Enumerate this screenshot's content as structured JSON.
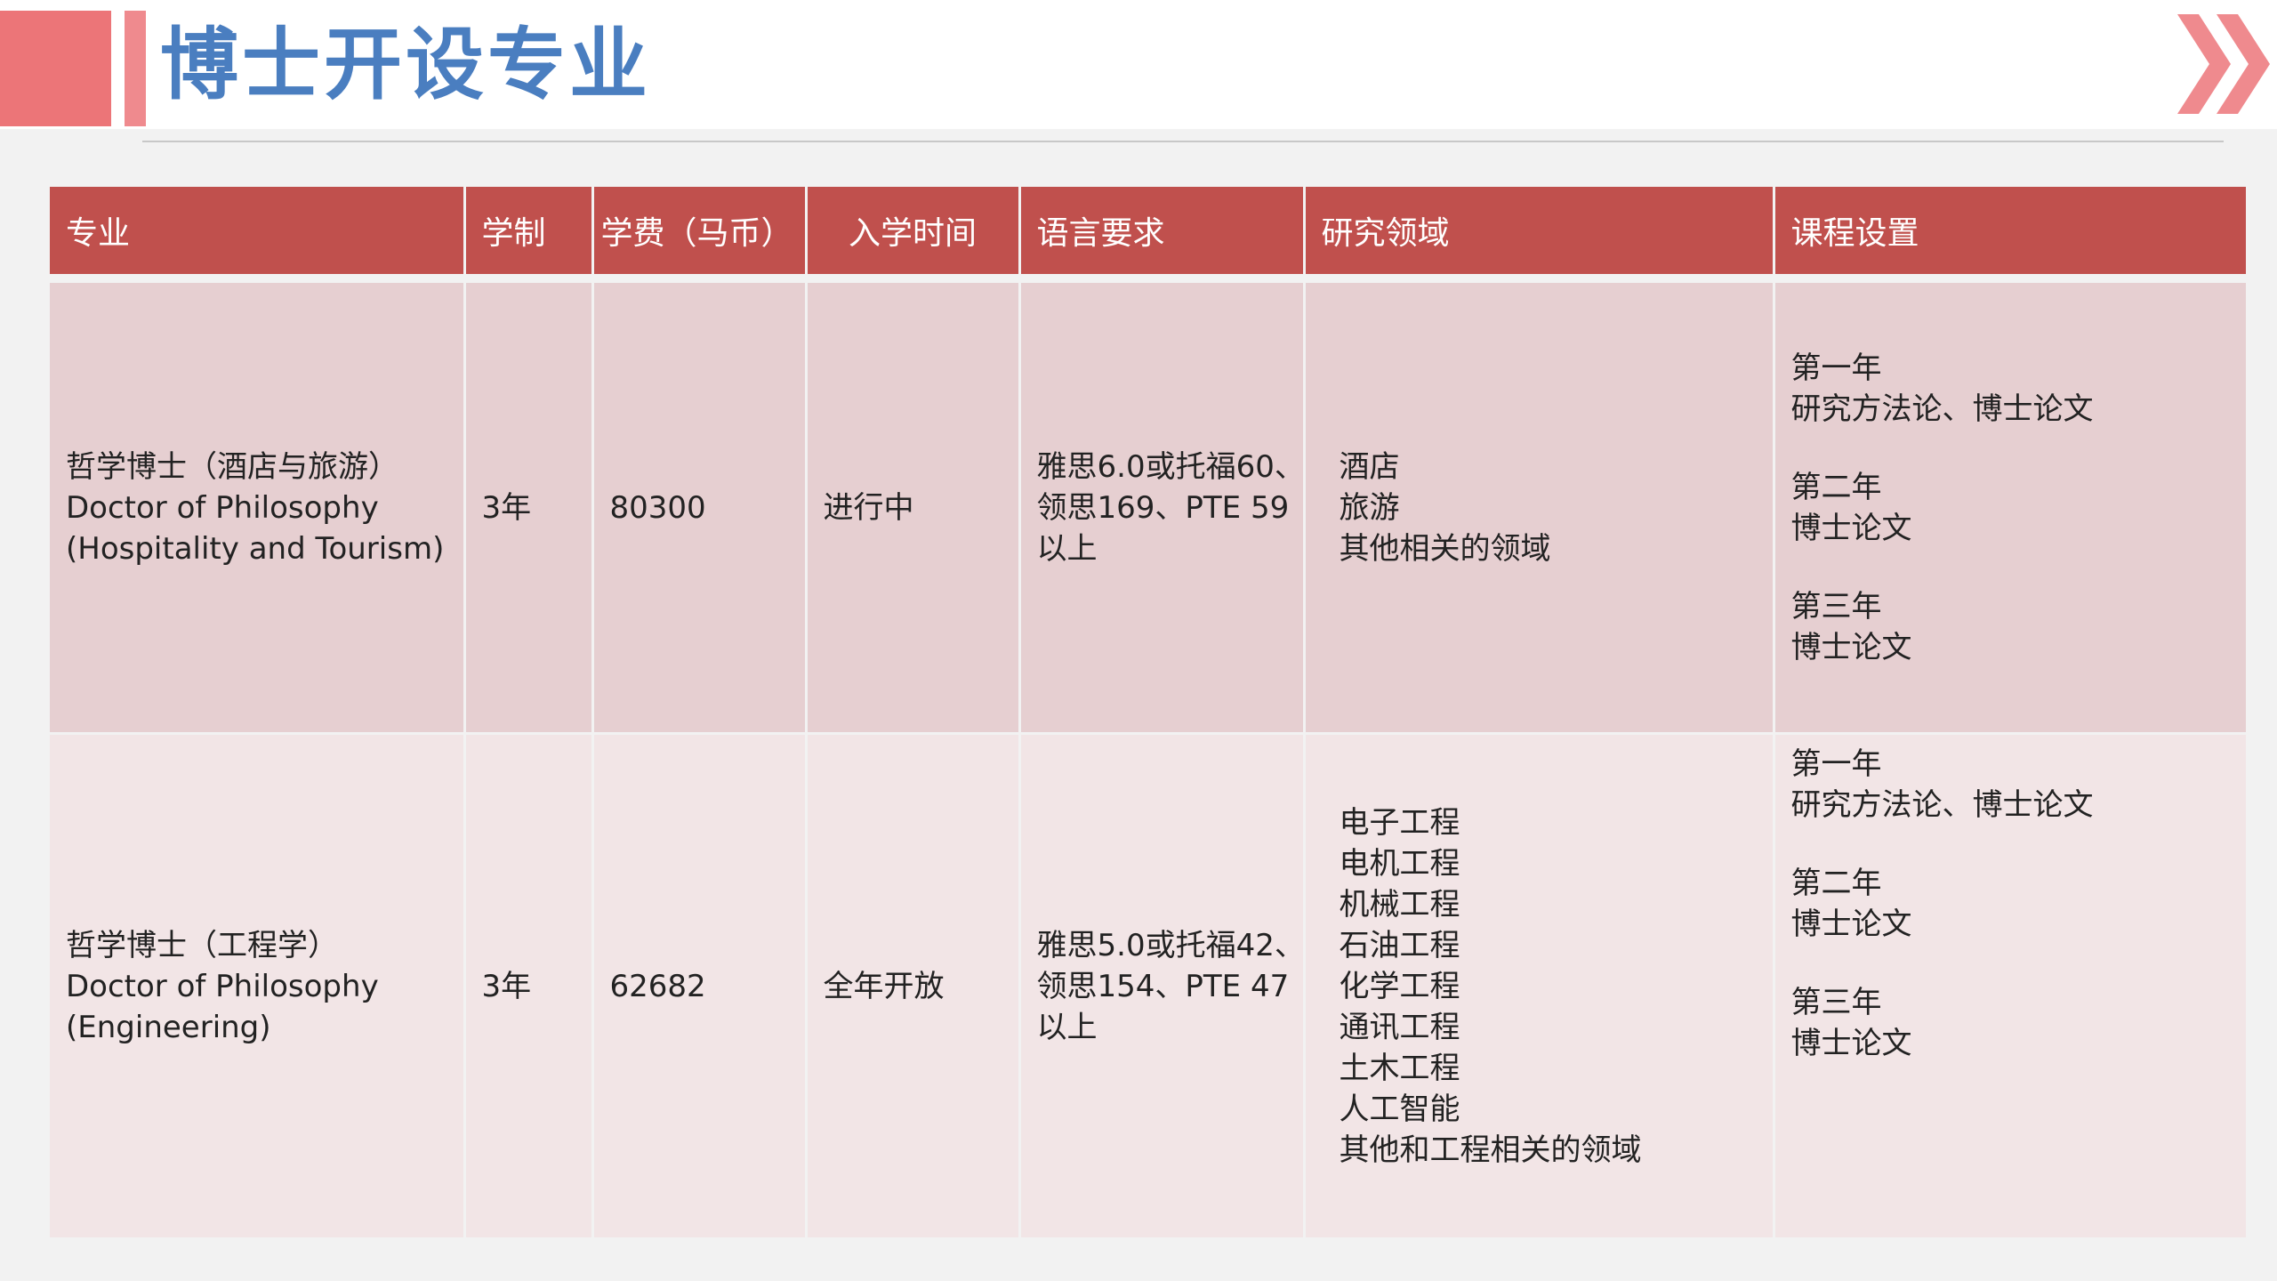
{
  "page": {
    "title": "博士开设专业"
  },
  "table": {
    "headers": [
      "专业",
      "学制",
      "学费（马币）",
      "入学时间",
      "语言要求",
      "研究领域",
      "课程设置"
    ],
    "rows": [
      {
        "major_cn": "哲学博士（酒店与旅游）",
        "major_en_1": "Doctor of Philosophy",
        "major_en_2": "(Hospitality and Tourism)",
        "duration": "3年",
        "fee": "80300",
        "intake": "进行中",
        "language": [
          "雅思6.0或托福60、",
          "领思169、PTE 59",
          "以上"
        ],
        "research": [
          "酒店",
          "旅游",
          "其他相关的领域"
        ],
        "curriculum": [
          {
            "year": "第一年",
            "content": "研究方法论、博士论文"
          },
          {
            "year": "第二年",
            "content": "博士论文"
          },
          {
            "year": "第三年",
            "content": "博士论文"
          }
        ]
      },
      {
        "major_cn": "哲学博士（工程学）",
        "major_en_1": "Doctor of Philosophy",
        "major_en_2": "(Engineering)",
        "duration": "3年",
        "fee": "62682",
        "intake": "全年开放",
        "language": [
          "雅思5.0或托福42、",
          "领思154、PTE 47",
          "以上"
        ],
        "research": [
          "电子工程",
          "电机工程",
          "机械工程",
          "石油工程",
          "化学工程",
          "通讯工程",
          "土木工程",
          "人工智能",
          "其他和工程相关的领域"
        ],
        "curriculum": [
          {
            "year": "第一年",
            "content": "研究方法论、博士论文"
          },
          {
            "year": "第二年",
            "content": "博士论文"
          },
          {
            "year": "第三年",
            "content": "博士论文"
          }
        ]
      }
    ]
  },
  "colors": {
    "header_bg": "#c0504d",
    "row1_bg": "#e6cfd1",
    "row2_bg": "#f2e5e6",
    "title": "#4a7ec0",
    "accent": "#ec7578"
  },
  "icons": {
    "top_right": "double-chevron-right-icon"
  }
}
